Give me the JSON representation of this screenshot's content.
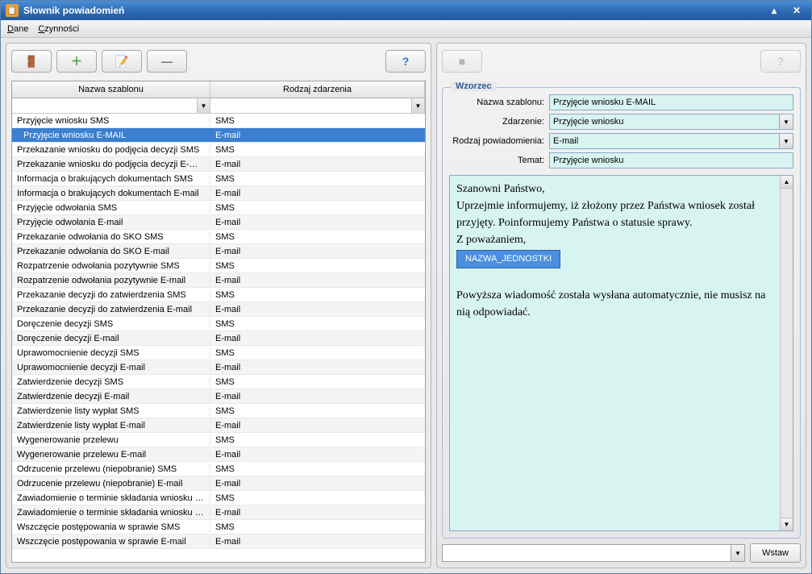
{
  "window": {
    "title": "Słownik powiadomień"
  },
  "menu": {
    "dane": "Dane",
    "czynnosci": "Czynności"
  },
  "toolbar_left": {
    "icons": {
      "exit": "📙",
      "add": "+",
      "edit": "✎",
      "remove": "−",
      "help": "?"
    }
  },
  "toolbar_right": {
    "icons": {
      "book": "▭",
      "help": "?"
    }
  },
  "table": {
    "headers": {
      "name": "Nazwa szablonu",
      "type": "Rodzaj zdarzenia"
    },
    "selected_index": 1,
    "rows": [
      {
        "name": "Przyjęcie wniosku SMS",
        "type": "SMS"
      },
      {
        "name": "Przyjęcie wniosku E-MAIL",
        "type": "E-mail"
      },
      {
        "name": "Przekazanie wniosku do podjęcia decyzji SMS",
        "type": "SMS"
      },
      {
        "name": "Przekazanie wniosku do podjęcia decyzji E-mail",
        "type": "E-mail"
      },
      {
        "name": "Informacja o brakujących dokumentach SMS",
        "type": "SMS"
      },
      {
        "name": "Informacja o brakujących dokumentach E-mail",
        "type": "E-mail"
      },
      {
        "name": "Przyjęcie odwołania SMS",
        "type": "SMS"
      },
      {
        "name": "Przyjęcie odwołania E-mail",
        "type": "E-mail"
      },
      {
        "name": "Przekazanie odwołania do SKO SMS",
        "type": "SMS"
      },
      {
        "name": "Przekazanie odwołania do SKO E-mail",
        "type": "E-mail"
      },
      {
        "name": "Rozpatrzenie odwołania pozytywnie SMS",
        "type": "SMS"
      },
      {
        "name": "Rozpatrzenie odwołania pozytywnie E-mail",
        "type": "E-mail"
      },
      {
        "name": "Przekazanie decyzji do zatwierdzenia SMS",
        "type": "SMS"
      },
      {
        "name": "Przekazanie decyzji do zatwierdzenia E-mail",
        "type": "E-mail"
      },
      {
        "name": "Doręczenie decyzji SMS",
        "type": "SMS"
      },
      {
        "name": "Doręczenie decyzji E-mail",
        "type": "E-mail"
      },
      {
        "name": "Uprawomocnienie decyzji SMS",
        "type": "SMS"
      },
      {
        "name": "Uprawomocnienie decyzji E-mail",
        "type": "E-mail"
      },
      {
        "name": "Zatwierdzenie decyzji SMS",
        "type": "SMS"
      },
      {
        "name": "Zatwierdzenie decyzji E-mail",
        "type": "E-mail"
      },
      {
        "name": "Zatwierdzenie listy wypłat SMS",
        "type": "SMS"
      },
      {
        "name": "Zatwierdzenie listy wypłat E-mail",
        "type": "E-mail"
      },
      {
        "name": "Wygenerowanie przelewu",
        "type": "SMS"
      },
      {
        "name": "Wygenerowanie przelewu E-mail",
        "type": "E-mail"
      },
      {
        "name": "Odrzucenie przelewu (niepobranie) SMS",
        "type": "SMS"
      },
      {
        "name": "Odrzucenie przelewu (niepobranie) E-mail",
        "type": "E-mail"
      },
      {
        "name": "Zawiadomienie o terminie składania wniosku SMS",
        "type": "SMS"
      },
      {
        "name": "Zawiadomienie o terminie składania wniosku E-...",
        "type": "E-mail"
      },
      {
        "name": "Wszczęcie postępowania w sprawie SMS",
        "type": "SMS"
      },
      {
        "name": "Wszczęcie postępowania w sprawie E-mail",
        "type": "E-mail"
      }
    ]
  },
  "form": {
    "legend": "Wzorzec",
    "labels": {
      "name": "Nazwa szablonu:",
      "event": "Zdarzenie:",
      "type": "Rodzaj powiadomienia:",
      "subject": "Temat:"
    },
    "values": {
      "name": "Przyjęcie wniosku E-MAIL",
      "event": "Przyjęcie wniosku",
      "type": "E-mail",
      "subject": "Przyjęcie wniosku"
    },
    "body": {
      "greeting": "Szanowni Państwo,",
      "line1": "Uprzejmie informujemy, iż złożony przez Państwa wniosek został przyjęty. Poinformujemy Państwa o statusie sprawy.",
      "signoff": "Z poważaniem,",
      "token": "NAZWA_JEDNOSTKI",
      "footer": "Powyższa wiadomość została wysłana automatycznie, nie musisz na nią odpowiadać."
    }
  },
  "bottom": {
    "insert": "Wstaw"
  }
}
